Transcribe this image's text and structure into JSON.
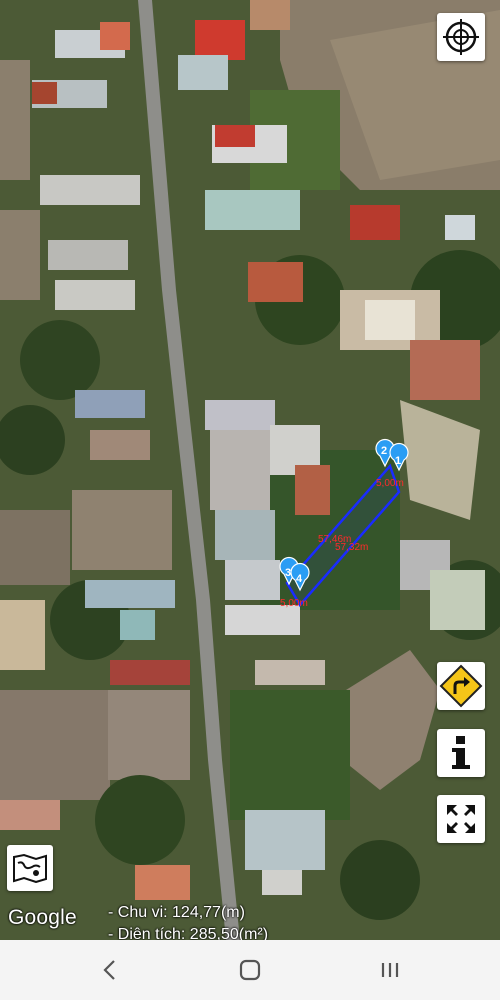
{
  "map": {
    "attribution": "Google",
    "pins": [
      "1",
      "2",
      "3",
      "4"
    ],
    "dimension_labels": [
      "5,00m",
      "57,46m",
      "57,32m",
      "5,00m"
    ],
    "polygon_color": "#1a2cff",
    "pin_color": "#2a9df4"
  },
  "controls": {
    "locate_icon": "crosshair-icon",
    "turn_icon": "turn-right-sign-icon",
    "info_icon": "info-icon",
    "fullscreen_icon": "expand-icon",
    "layers_icon": "map-layers-icon"
  },
  "measurements": {
    "perimeter": "- Chu vi: 124,77(m)",
    "area": "- Diện tích: 285,50(m²)"
  },
  "navbar": {
    "back_icon": "back-chevron-icon",
    "home_icon": "home-square-icon",
    "recent_icon": "recent-apps-icon"
  }
}
